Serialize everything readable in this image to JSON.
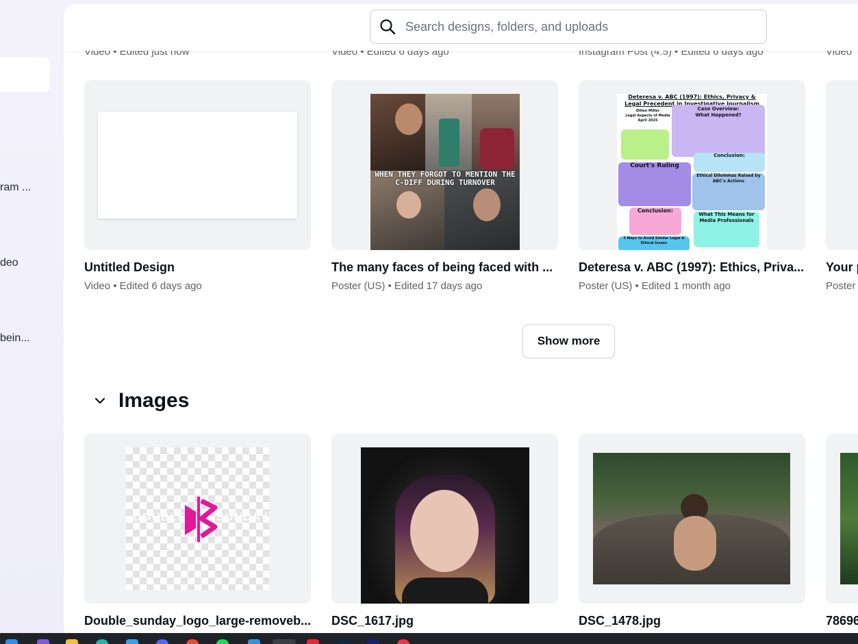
{
  "sidebar": {
    "items": [
      {
        "label": "ram ..."
      },
      {
        "label": "deo"
      },
      {
        "label": "bein..."
      }
    ]
  },
  "search": {
    "placeholder": "Search designs, folders, and uploads"
  },
  "previous_row": [
    {
      "meta": "Video • Edited just now"
    },
    {
      "meta": "Video • Edited 6 days ago"
    },
    {
      "meta": "Instagram Post (4:5) • Edited 6 days ago"
    },
    {
      "meta": "Video"
    }
  ],
  "designs": [
    {
      "title": "Untitled Design",
      "meta": "Video • Edited 6 days ago"
    },
    {
      "title": "The many faces of being faced with ...",
      "meta": "Poster (US) • Edited 17 days ago",
      "thumb_caption": "WHEN THEY FORGOT TO MENTION THE C-DIFF DURING TURNOVER"
    },
    {
      "title": "Deteresa v. ABC (1997): Ethics, Priva...",
      "meta": "Poster (US) • Edited 1 month ago",
      "poster": {
        "heading": "Deteresa v. ABC (1997): Ethics, Privacy & Legal Precedent in Investigative Journalism",
        "author": "Dillon Miller\nLegal Aspects of Media\nApril 2025",
        "box1": "Case Overview:\nWhat Happened?",
        "box2": "Court's Ruling",
        "box3": "Conclusion:",
        "box4": "Ethical Dilemmas Raised by ABC's Actions",
        "box5": "Conclusion:",
        "box6": "What This Means for Media Professionals",
        "box7": "3 Ways to Avoid Similar Legal & Ethical Issues"
      }
    },
    {
      "title": "Your p",
      "meta": "Poster"
    }
  ],
  "show_more_label": "Show more",
  "images_section": {
    "heading": "Images",
    "items": [
      {
        "title": "Double_sunday_logo_large-removeb...",
        "logo_left": "DOUBLE",
        "logo_right": "SUNDAY"
      },
      {
        "title": "DSC_1617.jpg"
      },
      {
        "title": "DSC_1478.jpg"
      },
      {
        "title": "78696"
      }
    ]
  },
  "colors": {
    "accent_logo": "#e0199a",
    "text_primary": "#0d1216",
    "text_secondary": "#5e6166",
    "thumb_bg": "#f1f2f4"
  }
}
